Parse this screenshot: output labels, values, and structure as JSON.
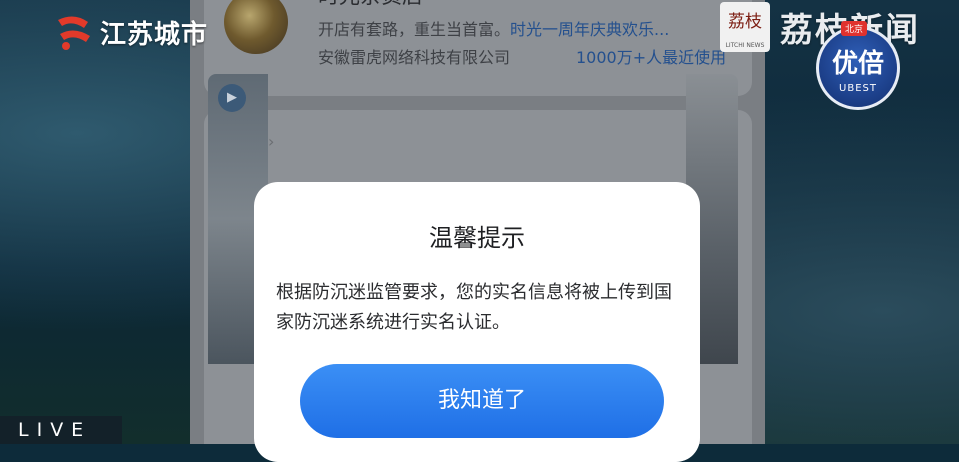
{
  "broadcast": {
    "channel_logo_text": "江苏城市",
    "live_label": "LIVE",
    "lizhi_logo_char": "荔枝",
    "lizhi_logo_sub": "LITCHI NEWS",
    "lizhi_name": "荔枝新闻",
    "ubest_main": "优倍",
    "ubest_sub": "UBEST",
    "ubest_tag": "北京"
  },
  "app": {
    "shop_title": "时光杂货店",
    "shop_desc_plain": "开店有套路，重生当首富。",
    "shop_desc_highlight": "时光一周年庆典欢乐...",
    "company": "安徽雷虎网络科技有限公司",
    "users": "1000万+人最近使用",
    "video_section_label": "视频",
    "video_section_chevron": "›"
  },
  "dialog": {
    "title": "温馨提示",
    "body": "根据防沉迷监管要求，您的实名信息将被上传到国家防沉迷系统进行实名认证。",
    "button_label": "我知道了"
  },
  "colors": {
    "dialog_button": "#1f6fe6",
    "dialog_bg": "#ffffff",
    "link_blue": "#24508e"
  }
}
